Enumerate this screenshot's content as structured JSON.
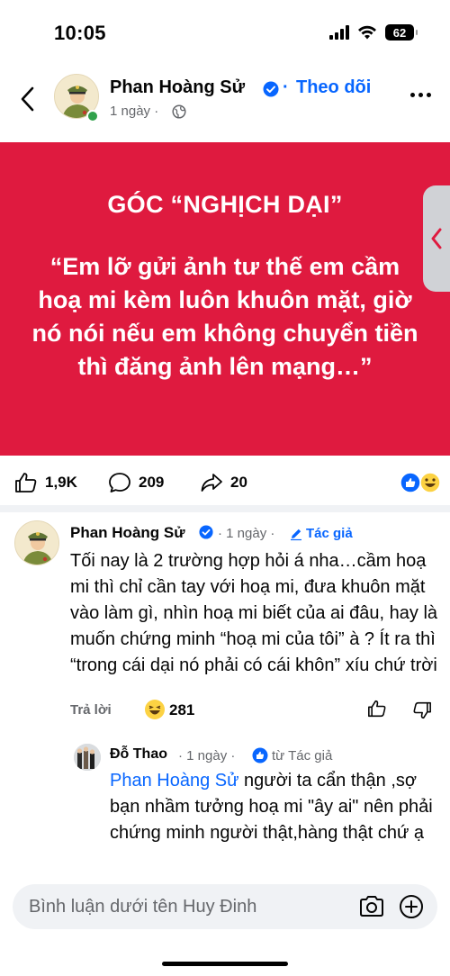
{
  "status_bar": {
    "time": "10:05",
    "battery": "62"
  },
  "post": {
    "author": "Phan Hoàng Sử",
    "separator": "·",
    "follow_label": "Theo dõi",
    "time": "1 ngày ·",
    "card_title": "GÓC “NGHỊCH DẠI”",
    "card_quote": "“Em lỡ gửi ảnh tư thế em cầm hoạ mi kèm luôn khuôn mặt, giờ nó nói nếu em không chuyển tiền thì đăng ảnh lên mạng…”",
    "likes": "1,9K",
    "comments": "209",
    "shares": "20"
  },
  "comments": [
    {
      "name": "Phan Hoàng Sử",
      "time": "· 1 ngày ·",
      "badge": "Tác giả",
      "text": "Tối nay là 2 trường hợp hỏi á nha…cầm hoạ mi thì chỉ cần tay với hoạ mi, đưa khuôn mặt vào làm gì, nhìn hoạ mi biết của ai đâu, hay là muốn chứng minh “hoạ mi của tôi” à ? Ít ra thì “trong cái dại nó phải có cái khôn” xíu chứ trời",
      "reply_label": "Trả lời",
      "reaction_count": "281"
    },
    {
      "name": "Đỗ Thao",
      "time": "· 1 ngày ·",
      "badge": "từ Tác giả",
      "mention": "Phan Hoàng Sử",
      "text": " người ta cẩn thận ,sợ bạn nhầm tưởng hoạ mi \"ây ai\" nên phải chứng minh người thật,hàng thật chứ ạ"
    }
  ],
  "input": {
    "placeholder": "Bình luận dưới tên Huy Đinh"
  },
  "colors": {
    "card": "#df1a3f",
    "link": "#0866ff",
    "muted": "#65676b"
  }
}
